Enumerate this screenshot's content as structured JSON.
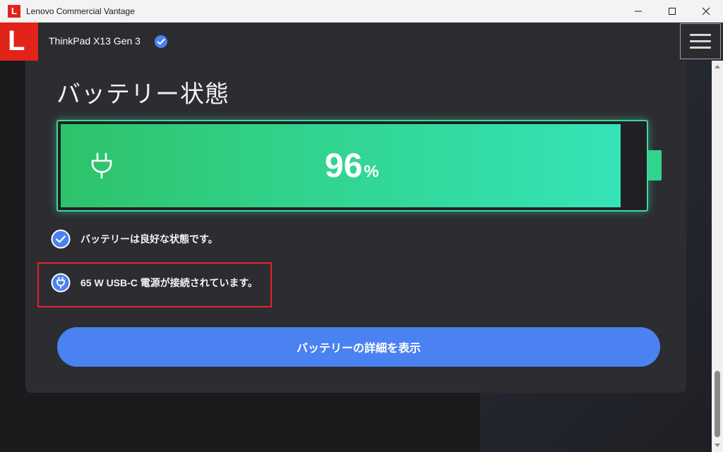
{
  "window": {
    "app_icon_letter": "L",
    "title": "Lenovo Commercial Vantage"
  },
  "header": {
    "brand_letter": "L",
    "device_name": "ThinkPad X13 Gen 3",
    "verified_icon": "check-circle-icon",
    "menu_icon": "hamburger-menu-icon"
  },
  "battery": {
    "section_title": "バッテリー状態",
    "charge_percent": 96,
    "percent_number": "96",
    "percent_sign": "%",
    "plug_icon": "plug-icon",
    "health_message": "バッテリーは良好な状態です。",
    "power_message": "65 W USB-C 電源が接続されています。",
    "details_button": "バッテリーの詳細を表示"
  },
  "colors": {
    "brand_red": "#e2231a",
    "battery_green_start": "#2ec26a",
    "battery_green_end": "#36e3b8",
    "accent_blue": "#4b82f1",
    "highlight_red": "#e0242b"
  }
}
